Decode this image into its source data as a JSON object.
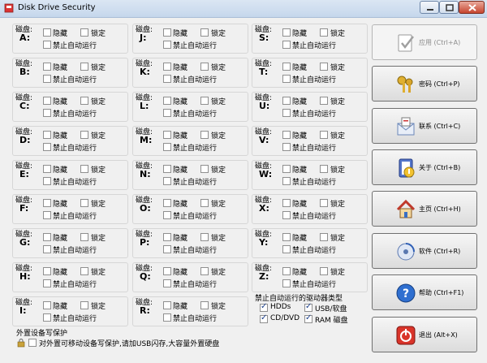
{
  "window": {
    "title": "Disk Drive Security"
  },
  "labels": {
    "disk": "磁盘:",
    "hidden": "隐藏",
    "lock": "锁定",
    "no_autorun": "禁止自动运行"
  },
  "drives": [
    "A:",
    "B:",
    "C:",
    "D:",
    "E:",
    "F:",
    "G:",
    "H:",
    "I:",
    "J:",
    "K:",
    "L:",
    "M:",
    "N:",
    "O:",
    "P:",
    "Q:",
    "R:",
    "S:",
    "T:",
    "U:",
    "V:",
    "W:",
    "X:",
    "Y:",
    "Z:"
  ],
  "autorun_types": {
    "title": "禁止自动运行的驱动器类型",
    "items": [
      {
        "label": "HDDs",
        "checked": true
      },
      {
        "label": "USB/软盘",
        "checked": true
      },
      {
        "label": "CD/DVD",
        "checked": true
      },
      {
        "label": "RAM 磁盘",
        "checked": true
      }
    ]
  },
  "external": {
    "title": "外置设备写保护",
    "option": "对外置可移动设备写保护,请加USB闪存,大容量外置硬盘"
  },
  "buttons": [
    {
      "label": "应用 (Ctrl+A)",
      "icon": "apply-icon",
      "disabled": true
    },
    {
      "label": "密码 (Ctrl+P)",
      "icon": "keys-icon",
      "disabled": false
    },
    {
      "label": "联系 (Ctrl+C)",
      "icon": "contact-icon",
      "disabled": false
    },
    {
      "label": "关于 (Ctrl+B)",
      "icon": "about-icon",
      "disabled": false
    },
    {
      "label": "主页 (Ctrl+H)",
      "icon": "home-icon",
      "disabled": false
    },
    {
      "label": "软件 (Ctrl+R)",
      "icon": "software-icon",
      "disabled": false
    },
    {
      "label": "帮助 (Ctrl+F1)",
      "icon": "help-icon",
      "disabled": false
    },
    {
      "label": "退出 (Alt+X)",
      "icon": "exit-icon",
      "disabled": false
    }
  ]
}
